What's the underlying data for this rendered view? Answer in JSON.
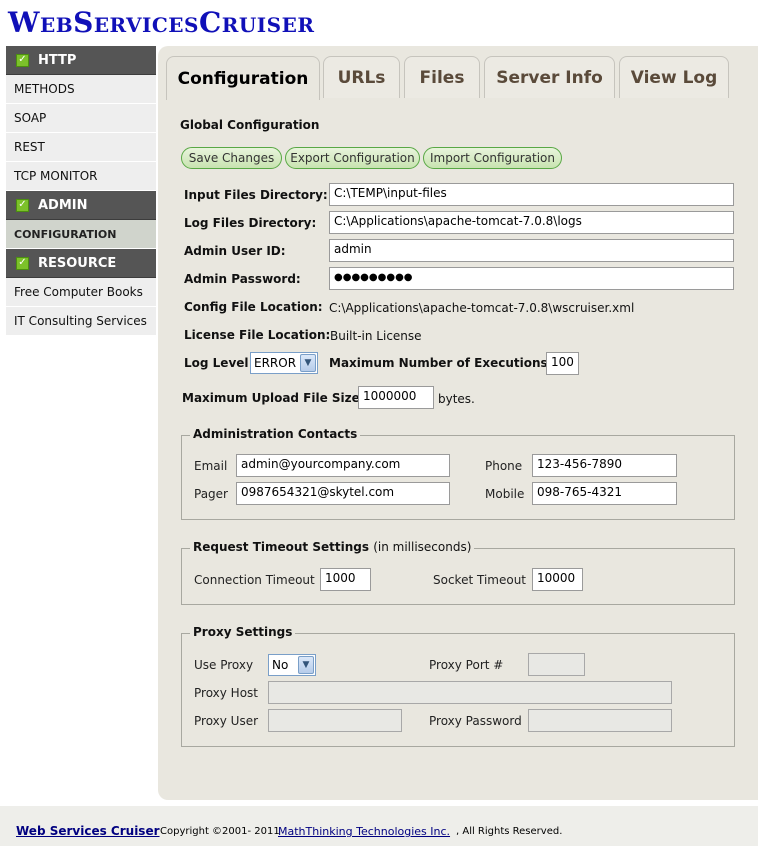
{
  "app": {
    "title": "WebServicesCruiser"
  },
  "sidebar": {
    "sections": [
      {
        "title": "HTTP",
        "items": [
          "METHODS",
          "SOAP",
          "REST",
          "TCP MONITOR"
        ]
      },
      {
        "title": "ADMIN",
        "items": [
          "CONFIGURATION"
        ]
      },
      {
        "title": "RESOURCE",
        "items": [
          "Free Computer Books",
          "IT Consulting Services"
        ]
      }
    ],
    "active_item": "CONFIGURATION"
  },
  "tabs": [
    "Configuration",
    "URLs",
    "Files",
    "Server Info",
    "View Log"
  ],
  "active_tab": "Configuration",
  "global": {
    "heading": "Global Configuration",
    "buttons": {
      "save": "Save Changes",
      "export": "Export Configuration",
      "import": "Import Configuration"
    },
    "input_dir_label": "Input Files Directory:",
    "input_dir_value": "C:\\TEMP\\input-files",
    "log_dir_label": "Log Files Directory:",
    "log_dir_value": "C:\\Applications\\apache-tomcat-7.0.8\\logs",
    "admin_id_label": "Admin User ID:",
    "admin_id_value": "admin",
    "admin_pw_label": "Admin Password:",
    "admin_pw_value": "●●●●●●●●●",
    "config_loc_label": "Config File Location:",
    "config_loc_value": "C:\\Applications\\apache-tomcat-7.0.8\\wscruiser.xml",
    "license_loc_label": "License File Location:",
    "license_loc_value": "Built-in License",
    "log_level_label": "Log Level",
    "log_level_value": "ERROR",
    "max_exec_label": "Maximum Number of Executions:",
    "max_exec_value": "100",
    "max_upload_label": "Maximum Upload File Size:",
    "max_upload_value": "1000000",
    "max_upload_unit": "bytes."
  },
  "contacts": {
    "legend": "Administration Contacts",
    "email_label": "Email",
    "email_value": "admin@yourcompany.com",
    "phone_label": "Phone",
    "phone_value": "123-456-7890",
    "pager_label": "Pager",
    "pager_value": "0987654321@skytel.com",
    "mobile_label": "Mobile",
    "mobile_value": "098-765-4321"
  },
  "timeout": {
    "legend": "Request Timeout Settings",
    "legend_sub": "(in milliseconds)",
    "conn_label": "Connection Timeout",
    "conn_value": "1000",
    "socket_label": "Socket Timeout",
    "socket_value": "10000"
  },
  "proxy": {
    "legend": "Proxy Settings",
    "use_label": "Use Proxy",
    "use_value": "No",
    "port_label": "Proxy Port #",
    "port_value": "",
    "host_label": "Proxy Host",
    "host_value": "",
    "user_label": "Proxy User",
    "user_value": "",
    "password_label": "Proxy Password",
    "password_value": ""
  },
  "footer": {
    "link": "Web Services Cruiser",
    "copyright": "Copyright ©2001- 2011",
    "company": "MathThinking Technologies Inc.",
    "rights": ", All Rights Reserved."
  },
  "colors": {
    "title": "#1010b8",
    "sidebar_header": "#555555",
    "button_border": "#59a845",
    "panel": "#e9e7df"
  }
}
